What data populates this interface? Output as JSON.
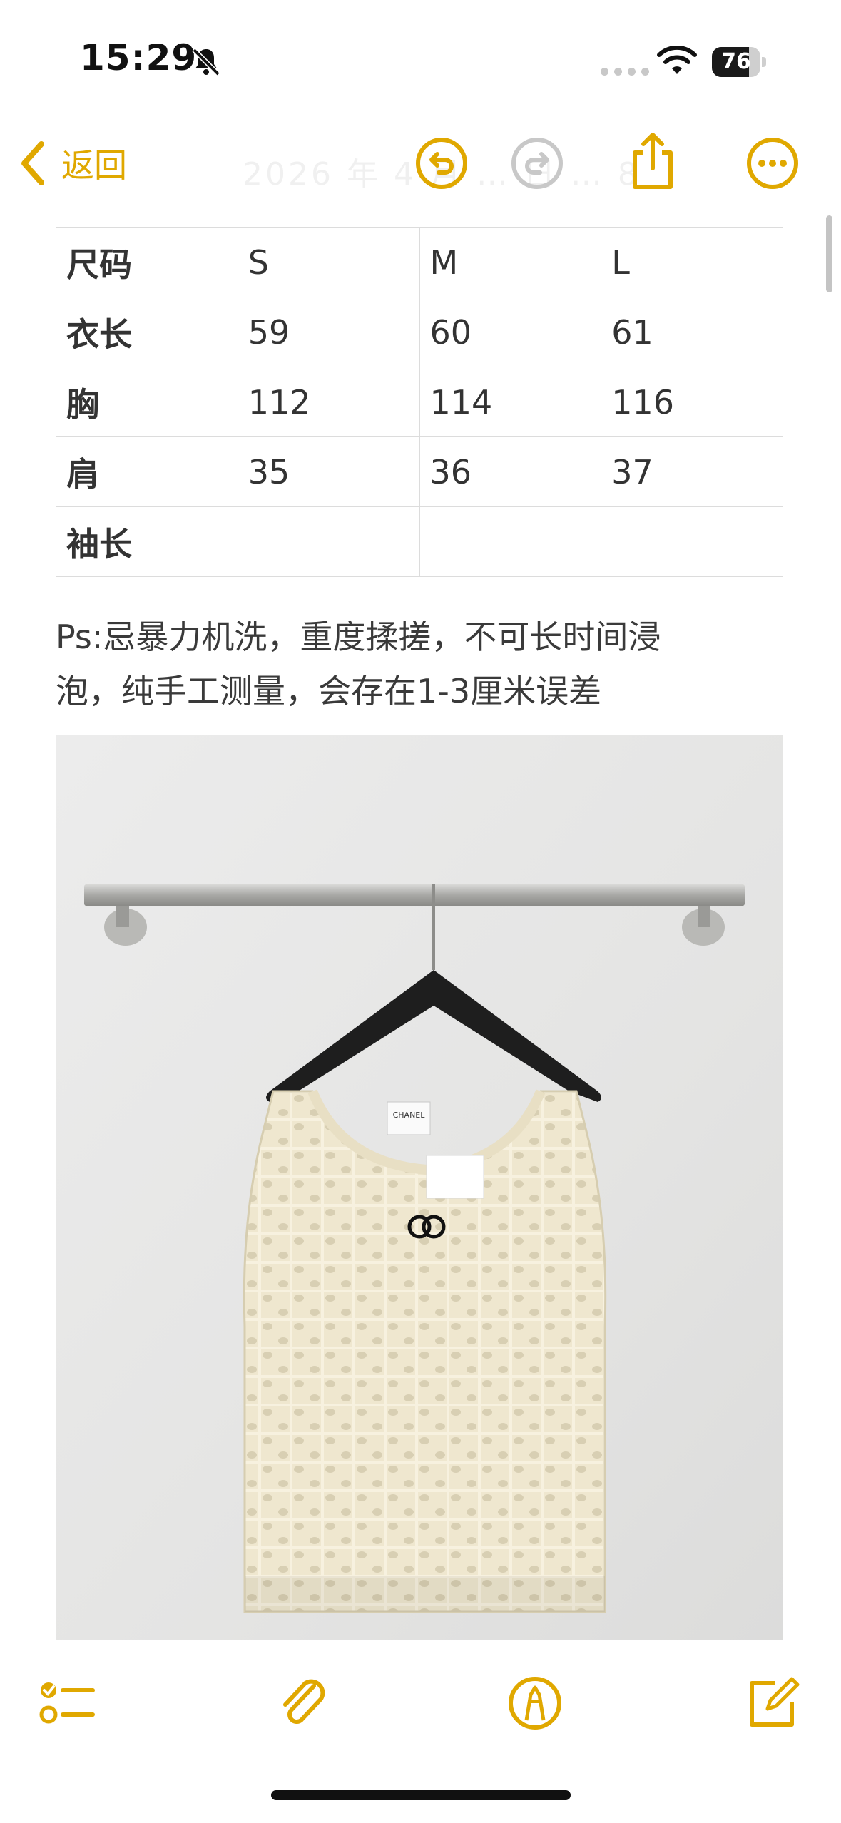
{
  "status_bar": {
    "time": "15:29",
    "battery_level": "76",
    "battery_fraction": 0.76,
    "icons": [
      "bell-slash-icon",
      "cellular-signal-icon",
      "wifi-icon",
      "battery-icon"
    ]
  },
  "nav": {
    "back_label": "返回",
    "title": "2026 年 4 月 … 日 … 8",
    "icons": [
      "undo-icon",
      "redo-icon",
      "share-icon",
      "more-icon"
    ]
  },
  "size_table": {
    "rows": [
      [
        "尺码",
        "S",
        "M",
        "L"
      ],
      [
        "衣长",
        "59",
        "60",
        "61"
      ],
      [
        "胸",
        "112",
        "114",
        "116"
      ],
      [
        "肩",
        "35",
        "36",
        "37"
      ],
      [
        "袖长",
        "",
        "",
        ""
      ]
    ]
  },
  "note": {
    "line1": "Ps:忌暴力机洗，重度揉搓，不可长时间浸",
    "line2": "泡，纯手工测量，会存在1-3厘米误差"
  },
  "photo": {
    "label_brand": "CHANEL"
  },
  "toolbar": {
    "icons": [
      "checklist-icon",
      "paperclip-icon",
      "markup-pen-icon",
      "compose-icon"
    ]
  },
  "colors": {
    "accent": "#E0A800",
    "disabled": "#C8C8C8",
    "text": "#333333",
    "border": "#DCDCDC"
  }
}
